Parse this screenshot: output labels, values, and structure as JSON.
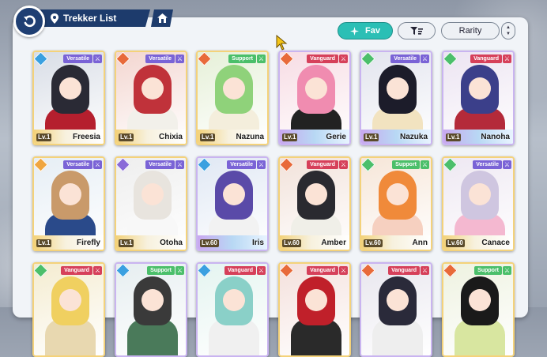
{
  "header": {
    "title": "Trekker List"
  },
  "toolbar": {
    "fav_label": "Fav",
    "rarity_label": "Rarity"
  },
  "colors": {
    "navy": "#1d3b6c",
    "teal": "#2bbfb5",
    "versatile": "#7a63d6",
    "support": "#4bbf6a",
    "vanguard": "#d6405a"
  },
  "cards": [
    {
      "name": "Freesia",
      "role": "Versatile",
      "level": "Lv.1",
      "element": "water",
      "rarity": "gold"
    },
    {
      "name": "Chixia",
      "role": "Versatile",
      "level": "Lv.1",
      "element": "fire",
      "rarity": "gold"
    },
    {
      "name": "Nazuna",
      "role": "Support",
      "level": "Lv.1",
      "element": "fire",
      "rarity": "gold"
    },
    {
      "name": "Gerie",
      "role": "Vanguard",
      "level": "Lv.1",
      "element": "fire",
      "rarity": "purple"
    },
    {
      "name": "Nazuka",
      "role": "Versatile",
      "level": "Lv.1",
      "element": "wind",
      "rarity": "purple"
    },
    {
      "name": "Nanoha",
      "role": "Vanguard",
      "level": "Lv.1",
      "element": "wind",
      "rarity": "purple"
    },
    {
      "name": "Firefly",
      "role": "Versatile",
      "level": "Lv.1",
      "element": "light",
      "rarity": "gold"
    },
    {
      "name": "Otoha",
      "role": "Versatile",
      "level": "Lv.1",
      "element": "dark",
      "rarity": "gold"
    },
    {
      "name": "Iris",
      "role": "Versatile",
      "level": "Lv.60",
      "element": "water",
      "rarity": "purple"
    },
    {
      "name": "Amber",
      "role": "Vanguard",
      "level": "Lv.60",
      "element": "fire",
      "rarity": "gold"
    },
    {
      "name": "Ann",
      "role": "Support",
      "level": "Lv.60",
      "element": "wind",
      "rarity": "gold"
    },
    {
      "name": "Canace",
      "role": "Versatile",
      "level": "Lv.60",
      "element": "wind",
      "rarity": "gold"
    },
    {
      "name": "",
      "role": "Vanguard",
      "level": "",
      "element": "wind",
      "rarity": "gold"
    },
    {
      "name": "",
      "role": "Support",
      "level": "",
      "element": "water",
      "rarity": "purple"
    },
    {
      "name": "",
      "role": "Vanguard",
      "level": "",
      "element": "water",
      "rarity": "purple"
    },
    {
      "name": "",
      "role": "Vanguard",
      "level": "",
      "element": "fire",
      "rarity": "gold"
    },
    {
      "name": "",
      "role": "Vanguard",
      "level": "",
      "element": "fire",
      "rarity": "purple"
    },
    {
      "name": "",
      "role": "Support",
      "level": "",
      "element": "fire",
      "rarity": "gold"
    }
  ]
}
